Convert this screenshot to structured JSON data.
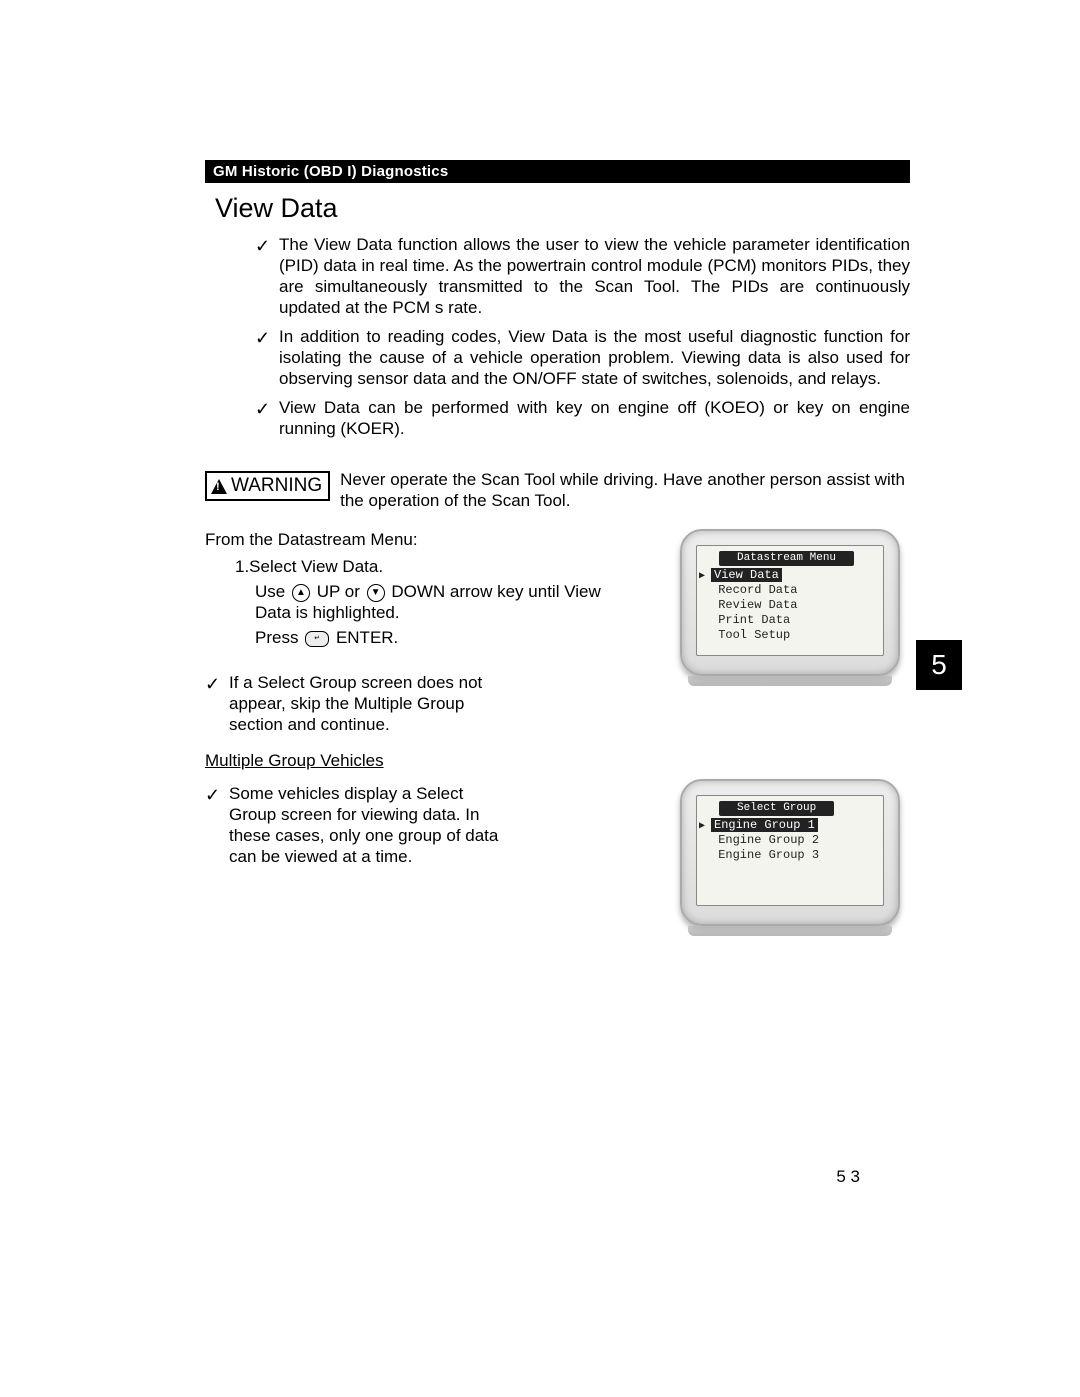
{
  "header": {
    "chapter": "GM Historic (OBD I) Diagnostics"
  },
  "title": "View Data",
  "intro_checks": [
    "The View Data  function allows the user to view the vehicle parameter identification (PID) data in real time. As the powertrain control module (PCM) monitors PIDs, they are simultaneously transmitted to the Scan Tool. The PIDs are continuously updated at the PCM s rate.",
    "In addition to reading codes, View Data  is the most useful diagnostic function for isolating the cause of a vehicle operation problem. Viewing data is also used for observing sensor data and the ON/OFF state of switches, solenoids, and relays.",
    "View Data can be performed with key on engine off (KOEO) or key on engine running (KOER)."
  ],
  "warning": {
    "label": "WARNING",
    "text": "Never operate the Scan Tool while driving. Have another person assist with the operation of the Scan Tool."
  },
  "steps": {
    "intro": "From the Datastream Menu:",
    "step1": "1.Select  View Data.",
    "sub_use_prefix": "Use",
    "sub_up": "UP or",
    "sub_down": "DOWN arrow key until View Data  is highlighted.",
    "sub_press_prefix": "Press",
    "sub_press_suffix": "ENTER."
  },
  "after_step_check": "If a Select Group   screen does not appear, skip the Multiple Group section and continue.",
  "subheading": "Multiple Group Vehicles",
  "multi_check": "Some vehicles display a Select Group screen for viewing data. In these cases, only one group of data can be viewed at a time.",
  "lcd1": {
    "title": "Datastream Menu",
    "items": [
      "View Data",
      "Record Data",
      "Review Data",
      "Print Data",
      "Tool Setup"
    ],
    "selected": 0
  },
  "lcd2": {
    "title": "Select Group",
    "items": [
      "Engine Group 1",
      "Engine Group 2",
      "Engine Group 3"
    ],
    "selected": 0
  },
  "section_tab": "5",
  "page_number": "5   3"
}
